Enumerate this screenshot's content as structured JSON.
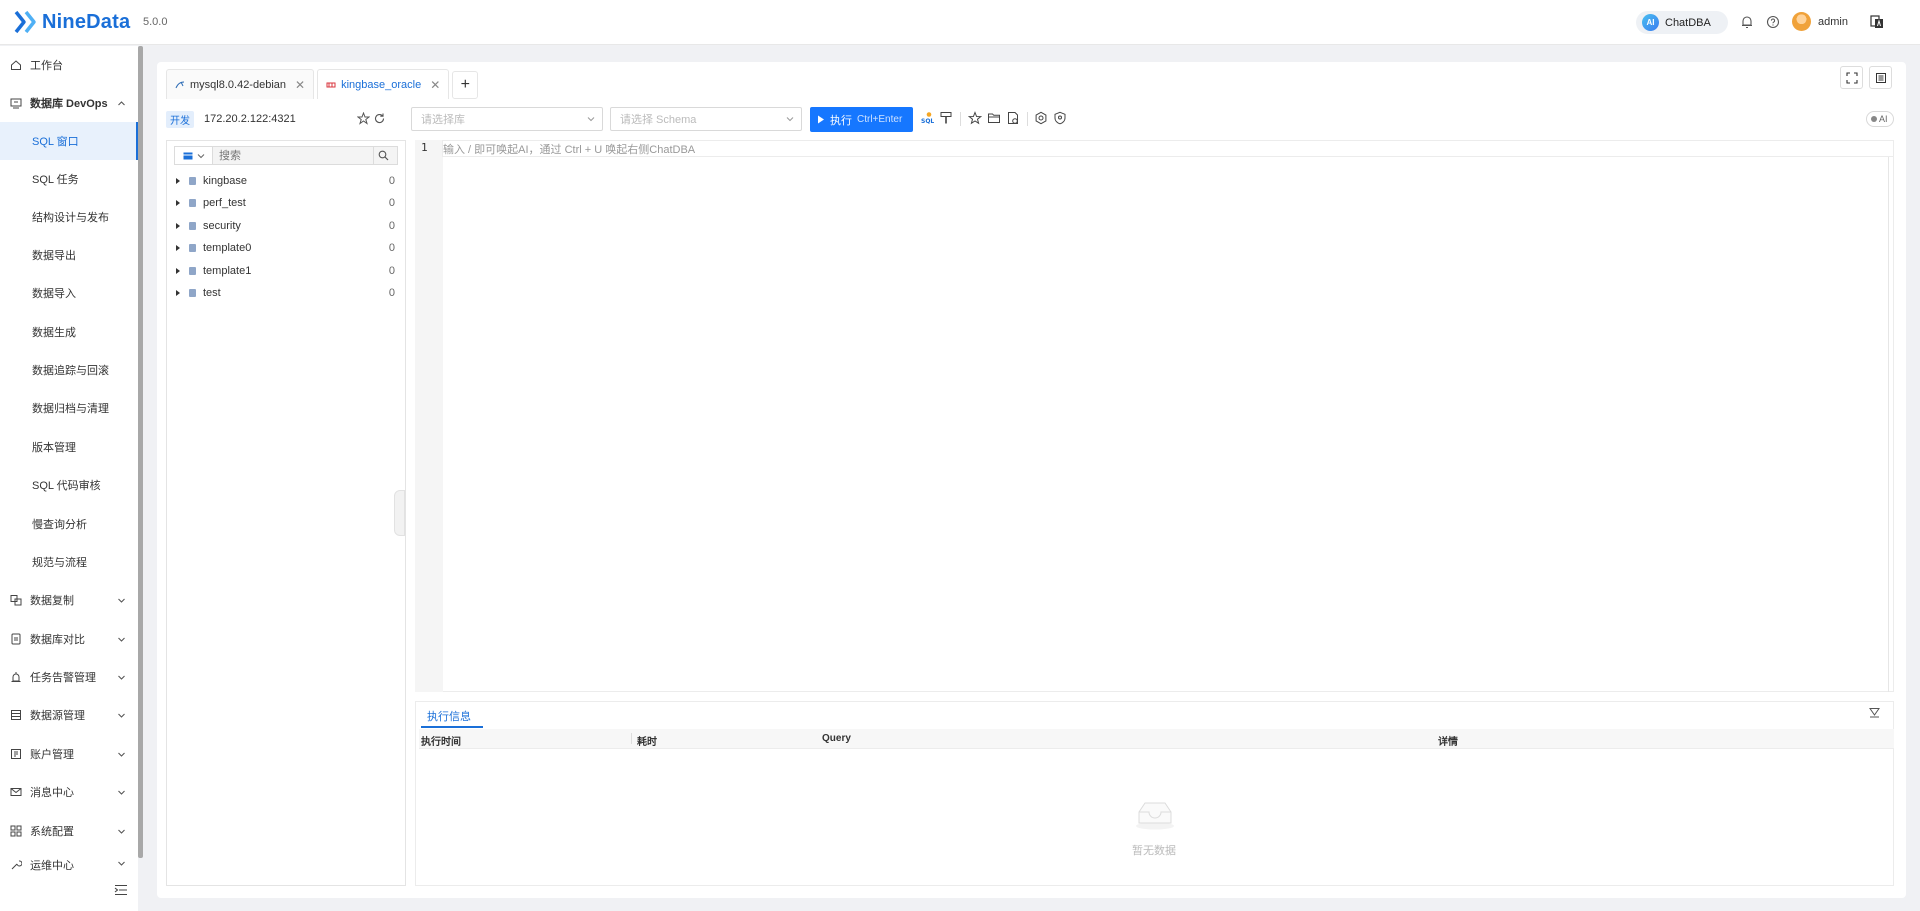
{
  "header": {
    "logo_text": "NineData",
    "version": "5.0.0",
    "chatdba_badge": "AI",
    "chatdba_label": "ChatDBA",
    "user_name": "admin"
  },
  "sidebar": {
    "workbench": "工作台",
    "devops_group": "数据库 DevOps",
    "devops_items": [
      "SQL 窗口",
      "SQL 任务",
      "结构设计与发布",
      "数据导出",
      "数据导入",
      "数据生成",
      "数据追踪与回滚",
      "数据归档与清理",
      "版本管理",
      "SQL 代码审核",
      "慢查询分析",
      "规范与流程"
    ],
    "groups": [
      "数据复制",
      "数据库对比",
      "任务告警管理",
      "数据源管理",
      "账户管理",
      "消息中心",
      "系统配置",
      "运维中心"
    ]
  },
  "tabs": [
    {
      "label": "mysql8.0.42-debian",
      "active": false
    },
    {
      "label": "kingbase_oracle",
      "active": true
    }
  ],
  "connection": {
    "env": "开发",
    "address": "172.20.2.122:4321"
  },
  "tree": {
    "search_placeholder": "搜索",
    "items": [
      {
        "name": "kingbase",
        "count": "0"
      },
      {
        "name": "perf_test",
        "count": "0"
      },
      {
        "name": "security",
        "count": "0"
      },
      {
        "name": "template0",
        "count": "0"
      },
      {
        "name": "template1",
        "count": "0"
      },
      {
        "name": "test",
        "count": "0"
      }
    ]
  },
  "toolbar": {
    "db_placeholder": "请选择库",
    "schema_placeholder": "请选择 Schema",
    "run_label": "执行",
    "run_shortcut": "Ctrl+Enter",
    "ai_toggle": "AI"
  },
  "editor": {
    "line_number": "1",
    "placeholder": "输入 / 即可唤起AI，通过 Ctrl + U 唤起右侧ChatDBA"
  },
  "results": {
    "tab_label": "执行信息",
    "columns": [
      "执行时间",
      "耗时",
      "Query",
      "详情"
    ],
    "empty_text": "暂无数据"
  },
  "colors": {
    "brand": "#1a6fd8",
    "primary_button": "#1677ff"
  }
}
